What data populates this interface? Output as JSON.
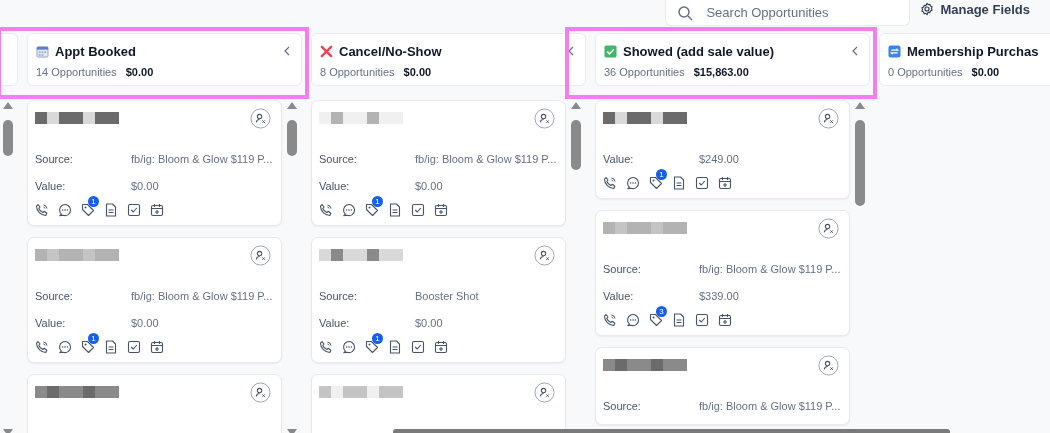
{
  "toolbar": {
    "search": {
      "placeholder": "Search Opportunities"
    },
    "manage_fields": "Manage Fields"
  },
  "columns": [
    {
      "title": "Appt Booked",
      "kind": "calendar",
      "count": "14 Opportunities",
      "amount": "$0.00",
      "collapsible": true,
      "highlighted": true,
      "cards": [
        {
          "assigned": false,
          "fields": [
            {
              "label": "Source:",
              "value": "fb/ig: Bloom & Glow $119 P..."
            },
            {
              "label": "Value:",
              "value": "$0.00"
            }
          ],
          "badge": "1"
        },
        {
          "assigned": false,
          "fields": [
            {
              "label": "Source:",
              "value": "fb/ig: Bloom & Glow $119 P..."
            },
            {
              "label": "Value:",
              "value": "$0.00"
            }
          ],
          "badge": "1"
        },
        {
          "assigned": false
        }
      ]
    },
    {
      "title": "Cancel/No-Show",
      "kind": "cancelled",
      "count": "8 Opportunities",
      "amount": "$0.00",
      "collapsible": true,
      "highlighted": false,
      "cards": [
        {
          "assigned": false,
          "fields": [
            {
              "label": "Source:",
              "value": "fb/ig: Bloom & Glow $119 P..."
            },
            {
              "label": "Value:",
              "value": "$0.00"
            }
          ],
          "badge": "1"
        },
        {
          "assigned": false,
          "fields": [
            {
              "label": "Source:",
              "value": "Booster Shot"
            },
            {
              "label": "Value:",
              "value": "$0.00"
            }
          ],
          "badge": "1"
        },
        {
          "assigned": false
        }
      ]
    },
    {
      "title": "Showed (add sale value)",
      "kind": "done",
      "count": "36 Opportunities",
      "amount": "$15,863.00",
      "collapsible": true,
      "highlighted": true,
      "cards": [
        {
          "assigned": false,
          "fields": [
            {
              "label": "Value:",
              "value": "$249.00"
            }
          ],
          "badge": "1"
        },
        {
          "assigned": false,
          "fields": [
            {
              "label": "Source:",
              "value": "fb/ig: Bloom & Glow $119 P..."
            },
            {
              "label": "Value:",
              "value": "$339.00"
            }
          ],
          "badge": "3"
        },
        {
          "assigned": false,
          "fields": [
            {
              "label": "Source:",
              "value": "fb/ig: Bloom & Glow $119 P..."
            }
          ]
        }
      ]
    },
    {
      "title": "Membership Purchas",
      "kind": "membership",
      "count": "0 Opportunities",
      "amount": "$0.00",
      "collapsible": false,
      "highlighted": false
    }
  ]
}
